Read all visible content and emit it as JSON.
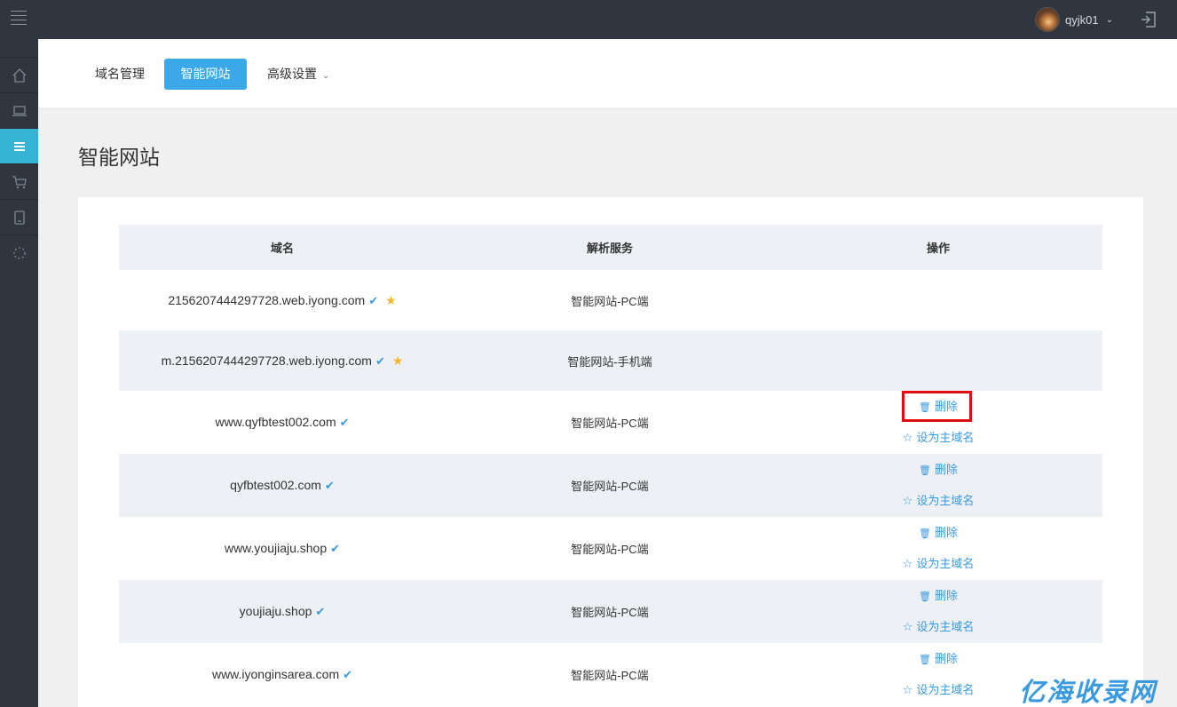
{
  "header": {
    "username": "qyjk01"
  },
  "tabs": [
    {
      "label": "域名管理"
    },
    {
      "label": "智能网站"
    },
    {
      "label": "高级设置"
    }
  ],
  "page": {
    "title": "智能网站"
  },
  "table": {
    "headers": [
      "域名",
      "解析服务",
      "操作"
    ],
    "rows": [
      {
        "domain": "2156207444297728.web.iyong.com",
        "verified": true,
        "starred": true,
        "service": "智能网站-PC端",
        "actions": []
      },
      {
        "domain": "m.2156207444297728.web.iyong.com",
        "verified": true,
        "starred": true,
        "service": "智能网站-手机端",
        "actions": []
      },
      {
        "domain": "www.qyfbtest002.com",
        "verified": true,
        "starred": false,
        "service": "智能网站-PC端",
        "actions": [
          "删除",
          "设为主域名"
        ]
      },
      {
        "domain": "qyfbtest002.com",
        "verified": true,
        "starred": false,
        "service": "智能网站-PC端",
        "actions": [
          "删除",
          "设为主域名"
        ]
      },
      {
        "domain": "www.youjiaju.shop",
        "verified": true,
        "starred": false,
        "service": "智能网站-PC端",
        "actions": [
          "删除",
          "设为主域名"
        ]
      },
      {
        "domain": "youjiaju.shop",
        "verified": true,
        "starred": false,
        "service": "智能网站-PC端",
        "actions": [
          "删除",
          "设为主域名"
        ]
      },
      {
        "domain": "www.iyonginsarea.com",
        "verified": true,
        "starred": false,
        "service": "智能网站-PC端",
        "actions": [
          "删除",
          "设为主域名"
        ]
      }
    ]
  },
  "icons": {
    "verified": "check-icon",
    "primary": "star-icon",
    "delete": "trash-icon",
    "set_primary": "star-outline-icon"
  },
  "colors": {
    "accent": "#3aa8e9",
    "sidebar_active": "#35b4d4",
    "topbar": "#2f3640",
    "link": "#3a9ae0",
    "star": "#f5b72b",
    "highlight_box": "#e00e0e"
  },
  "watermark": "亿海收录网"
}
